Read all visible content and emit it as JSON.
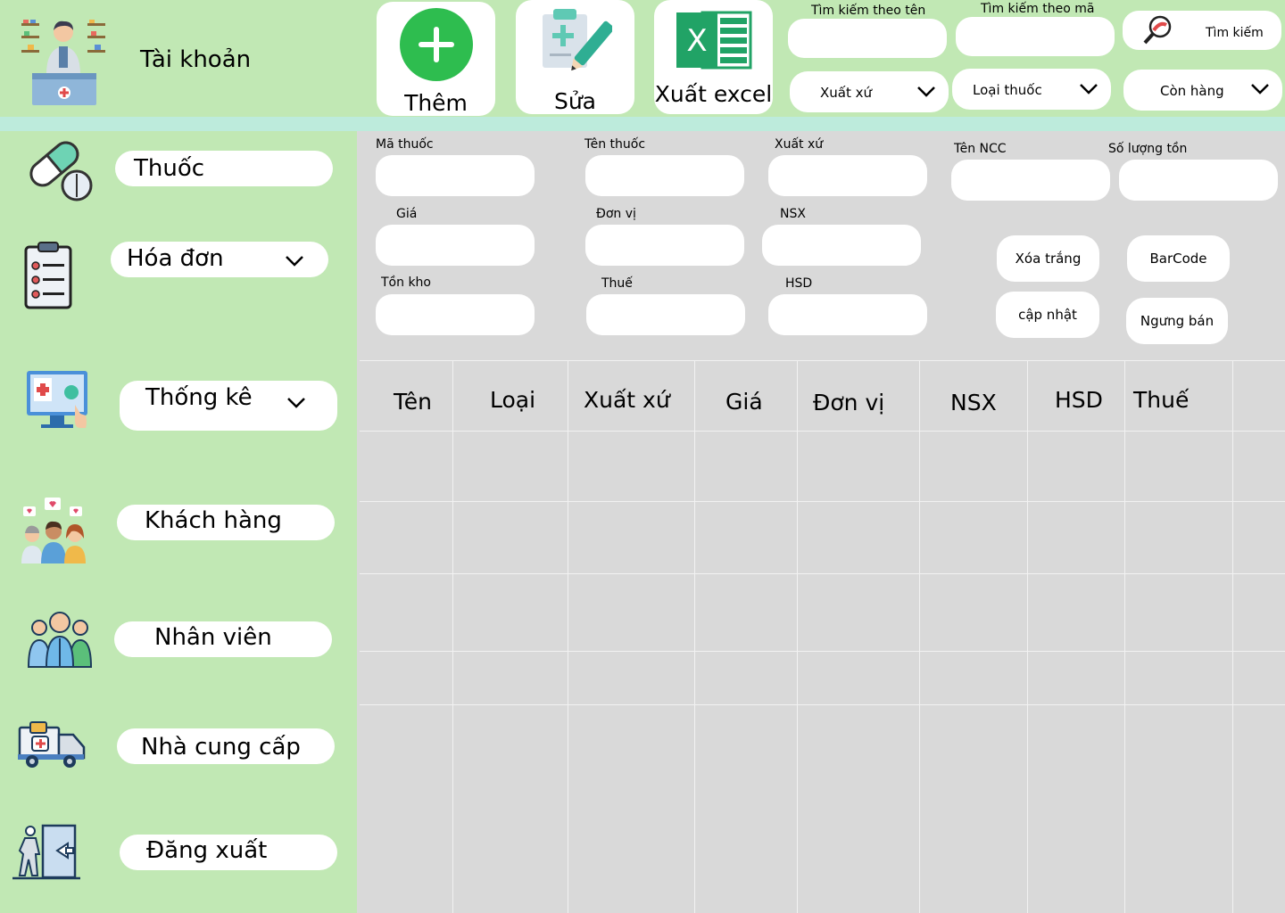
{
  "sidebar": {
    "account_label": "Tài khoản",
    "items": [
      {
        "label": "Thuốc"
      },
      {
        "label": "Hóa đơn"
      },
      {
        "label": "Thống kê"
      },
      {
        "label": "Khách hàng"
      },
      {
        "label": "Nhân viên"
      },
      {
        "label": "Nhà cung cấp"
      },
      {
        "label": "Đăng xuất"
      }
    ]
  },
  "toolbar": {
    "add_label": "Thêm",
    "edit_label": "Sửa",
    "export_label": "Xuất excel",
    "search_by_name_label": "Tìm kiếm theo tên",
    "search_by_code_label": "Tìm kiếm theo mã",
    "search_button_label": "Tìm kiếm",
    "filter_origin": "Xuất xứ",
    "filter_type": "Loại thuốc",
    "filter_stock": "Còn hàng"
  },
  "form": {
    "ma_thuoc": "Mã thuốc",
    "ten_thuoc": "Tên thuốc",
    "xuat_xu": "Xuất xứ",
    "ten_ncc": "Tên NCC",
    "so_luong_ton": "Số lượng tồn",
    "gia": "Giá",
    "don_vi": "Đơn vị",
    "nsx": "NSX",
    "ton_kho": "Tồn kho",
    "thue": "Thuế",
    "hsd": "HSD",
    "clear_label": "Xóa trắng",
    "barcode_label": "BarCode",
    "update_label": "cập nhật",
    "stop_sell_label": "Ngưng bán"
  },
  "table": {
    "columns": [
      "Tên",
      "Loại",
      "Xuất xứ",
      "Giá",
      "Đơn vị",
      "NSX",
      "HSD",
      "Thuế"
    ]
  },
  "colors": {
    "sidebar_bg": "#c1e8b4",
    "content_bg": "#d9d9d9",
    "band": "#bdebdc",
    "add_green": "#2ebd4f",
    "excel_green": "#21a366"
  }
}
